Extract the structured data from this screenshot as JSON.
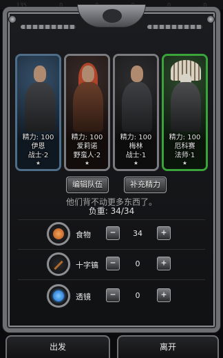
{
  "top_strip": [
    "135",
    "0",
    "0",
    "0",
    "0",
    "0"
  ],
  "party": [
    {
      "energy": "精力: 100",
      "name": "伊恩",
      "class": "战士·2",
      "star": "★"
    },
    {
      "energy": "精力: 100",
      "name": "爱莉诺",
      "class": "野蛮人·2",
      "star": "★"
    },
    {
      "energy": "精力: 100",
      "name": "梅林",
      "class": "战士·1",
      "star": "★"
    },
    {
      "energy": "精力: 100",
      "name": "厄科赛",
      "class": "法师·1",
      "star": "★"
    }
  ],
  "buttons": {
    "edit_team": "编辑队伍",
    "fill_energy": "补充精力"
  },
  "hint": "他们背不动更多东西了。",
  "weight": "负重: 34/34",
  "items": [
    {
      "icon": "food-icon",
      "name": "食物",
      "qty": "34"
    },
    {
      "icon": "pickaxe-icon",
      "name": "十字镐",
      "qty": "0"
    },
    {
      "icon": "lens-icon",
      "name": "透镜",
      "qty": "0"
    }
  ],
  "steppers": {
    "minus": "−",
    "plus": "+"
  },
  "bottom": {
    "depart": "出发",
    "leave": "离开"
  }
}
